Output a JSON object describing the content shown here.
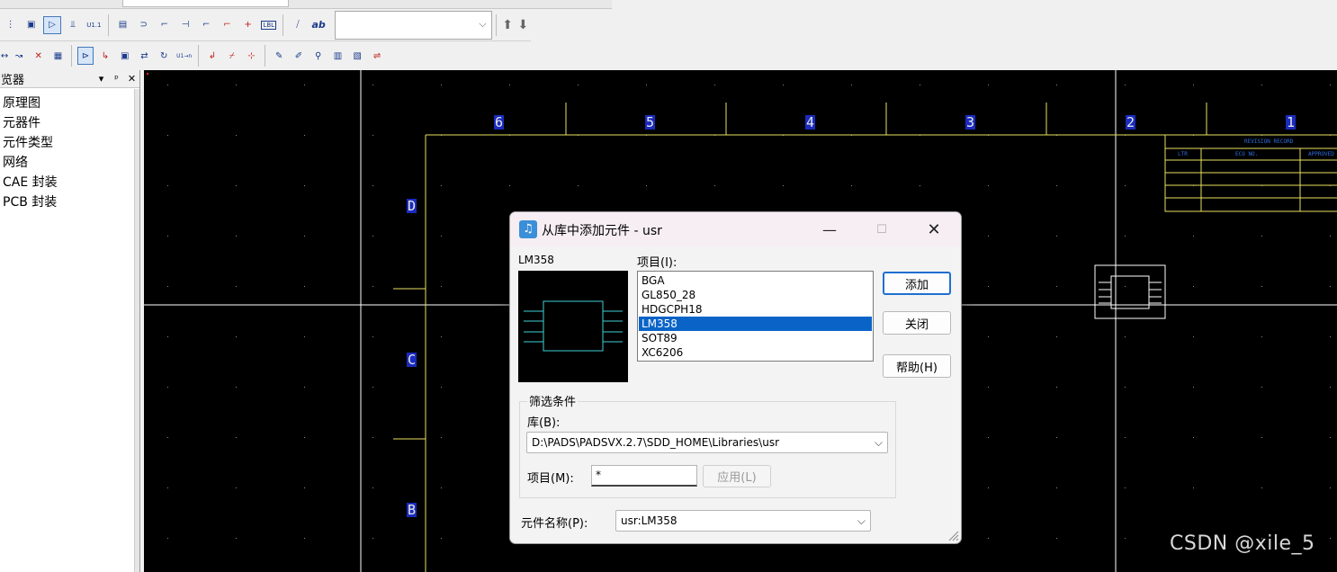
{
  "toolbar": {
    "combo_value": "",
    "row1_icons": [
      "component-icon",
      "gate-icon",
      "bus-icon",
      "u1-label-icon",
      "select-all-icon",
      "connector-icon",
      "wire-icon",
      "bus-entry-icon",
      "netlabel-icon",
      "power-icon",
      "pin-icon",
      "lbl-icon",
      "text-icon",
      "ab-text-icon"
    ],
    "row2_icons": [
      "move-icon",
      "copy-icon",
      "delete-icon",
      "properties-icon",
      "add-part-icon",
      "add-wire-icon",
      "add-bus-icon",
      "swap-icon",
      "rotate-icon",
      "auto-number-icon",
      "add-connector-icon",
      "add-power-icon",
      "add-ground-icon",
      "query-icon",
      "modify-icon",
      "filter-icon",
      "table-icon",
      "report-icon",
      "flip-icon"
    ],
    "u1_label": "U1.1",
    "lbl_label": "LBL",
    "ab_label": "ab",
    "u1n_label": "U1→n"
  },
  "browser": {
    "title": "览器",
    "pin_label": "▾",
    "items": [
      {
        "label": "原理图"
      },
      {
        "label": "元器件"
      },
      {
        "label": "元件类型"
      },
      {
        "label": "网络"
      },
      {
        "label": "CAE 封装"
      },
      {
        "label": "PCB 封装"
      }
    ]
  },
  "canvas": {
    "border_color": "#e8e060",
    "zone_columns": [
      "6",
      "5",
      "4",
      "3",
      "2",
      "1"
    ],
    "zone_rows": [
      "D",
      "C",
      "B"
    ],
    "revision": {
      "title": "REVISION RECORD",
      "col_ltr": "LTR",
      "col_eco": "ECO NO.",
      "col_approved": "APPROVED"
    }
  },
  "dialog": {
    "title": "从库中添加元件 - usr",
    "preview_label": "LM358",
    "items_label": "项目(I):",
    "items": [
      "BGA",
      "GL850_28",
      "HDGCPH18",
      "LM358",
      "SOT89",
      "XC6206"
    ],
    "selected_item": "LM358",
    "add_button": "添加",
    "close_button": "关闭",
    "help_button": "帮助(H)",
    "filter_group": "筛选条件",
    "library_label": "库(B):",
    "library_value": "D:\\PADS\\PADSVX.2.7\\SDD_HOME\\Libraries\\usr",
    "item_filter_label": "项目(M):",
    "item_filter_value": "*",
    "apply_button": "应用(L)",
    "part_name_label": "元件名称(P):",
    "part_name_value": "usr:LM358"
  },
  "watermark": "CSDN @xile_5",
  "colors": {
    "canvas_bg": "#000000",
    "sheet_border": "#e8e060",
    "zone_label_bg": "#1a2bbd",
    "selection": "#0a64c8",
    "preview_part": "#3fd0d8"
  }
}
